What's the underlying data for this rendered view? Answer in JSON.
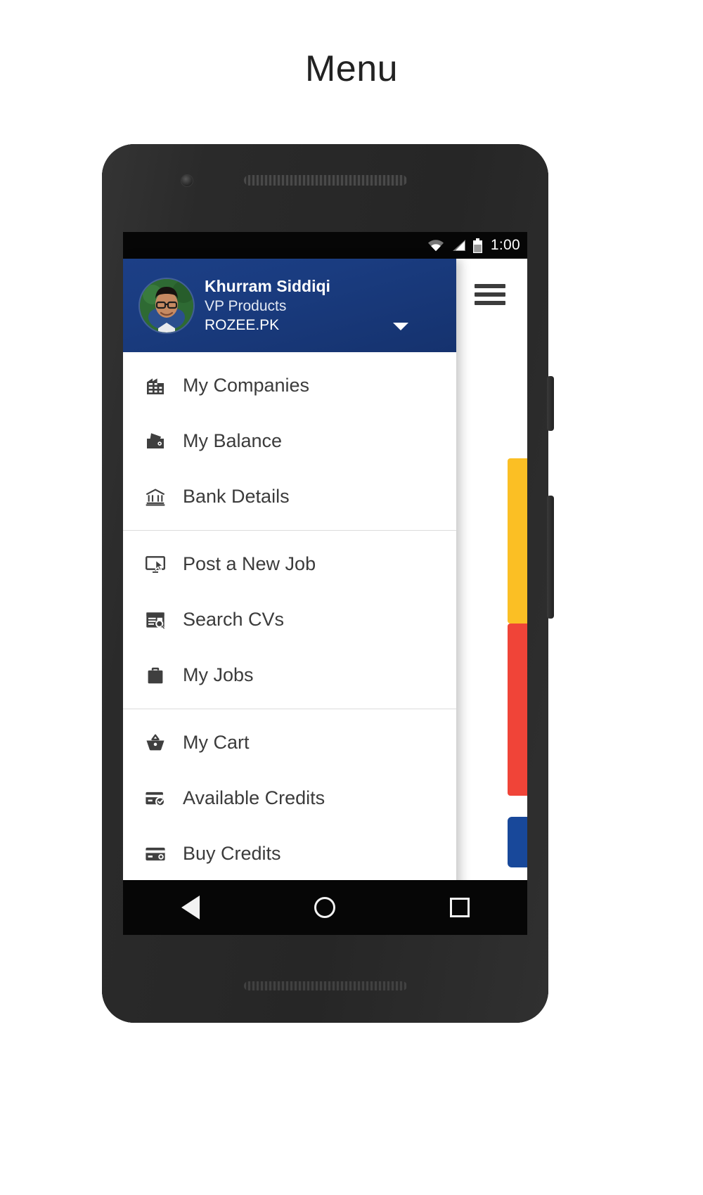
{
  "page": {
    "title": "Menu"
  },
  "status_bar": {
    "time": "1:00",
    "icons": [
      "wifi-icon",
      "cellular-signal-icon",
      "battery-icon"
    ]
  },
  "drawer": {
    "header": {
      "avatar": "user-avatar",
      "name": "Khurram Siddiqi",
      "role": "VP Products",
      "company": "ROZEE.PK",
      "caret": "chevron-down-icon",
      "background_color": "#1a3c80"
    },
    "groups": [
      {
        "items": [
          {
            "label": "My Companies",
            "icon": "company-building-icon"
          },
          {
            "label": "My Balance",
            "icon": "wallet-icon"
          },
          {
            "label": "Bank Details",
            "icon": "bank-icon"
          }
        ]
      },
      {
        "items": [
          {
            "label": "Post a New Job",
            "icon": "monitor-cursor-icon"
          },
          {
            "label": "Search CVs",
            "icon": "document-search-icon"
          },
          {
            "label": "My Jobs",
            "icon": "briefcase-icon"
          }
        ]
      },
      {
        "items": [
          {
            "label": "My Cart",
            "icon": "shopping-basket-icon"
          },
          {
            "label": "Available Credits",
            "icon": "credit-card-check-icon"
          },
          {
            "label": "Buy Credits",
            "icon": "credit-card-icon"
          }
        ]
      }
    ]
  },
  "behind_page": {
    "hamburger": "hamburger-menu-icon",
    "accent_strips": [
      {
        "name": "yellow-strip",
        "color": "#fbbf24"
      },
      {
        "name": "red-strip",
        "color": "#f04438"
      },
      {
        "name": "blue-strip",
        "color": "#18489a"
      }
    ]
  },
  "nav_bar": {
    "back": "back-triangle-icon",
    "home": "home-circle-icon",
    "recents": "recents-square-icon"
  }
}
